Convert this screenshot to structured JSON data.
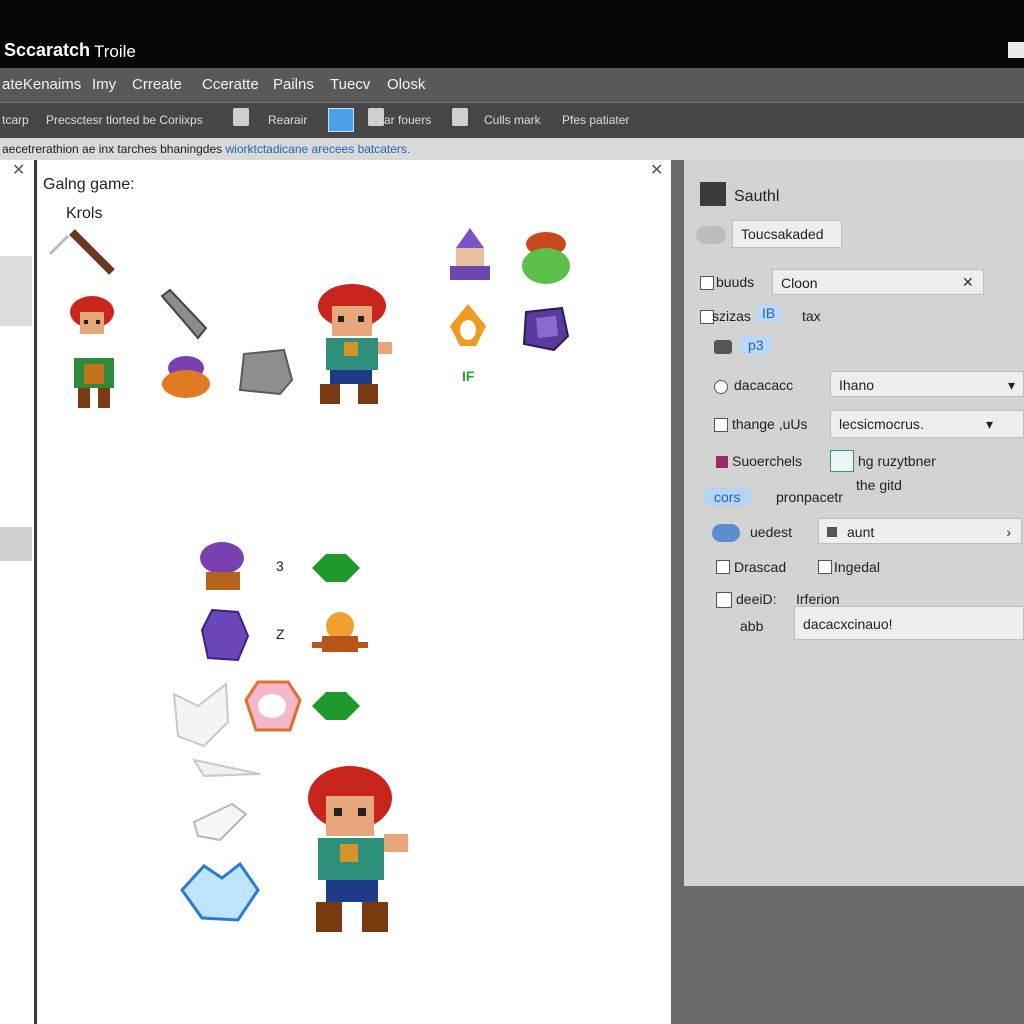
{
  "app": {
    "name": "Sccaratch",
    "window_title": "Troile"
  },
  "menu": [
    "ateKenaims",
    "Imy",
    "Crreate",
    "Cceratte",
    "Pailns",
    "Tuecv",
    "Olosk"
  ],
  "toolbar": {
    "item1": "tcarp",
    "item2": "Precsctesr tlorted be Coriixps",
    "item3": "Rearair",
    "item4": "ar fouers",
    "item5": "Culls mark",
    "item6": "Pfes patiater"
  },
  "status": {
    "text": "aecetrerathion ae inx tarches bhaningdes",
    "link": "wiorktctadicane arecees batcaters."
  },
  "main": {
    "title": "Galng game:",
    "assets_label": "Krols",
    "mark1": "IF",
    "mark2": "3",
    "mark3": "Z"
  },
  "props": {
    "title": "Sauthl",
    "loaded_button": "Toucsakaded",
    "buttons_label": "buuds",
    "buttons_value": "Cloon",
    "sizes_label": "szizas",
    "sizes_value": "IB",
    "sizes_suffix": "tax",
    "pos_value": "p3",
    "dropdown1_label": "dacacacc",
    "dropdown1_value": "Ihano",
    "dropdown2_label": "thange ,uUs",
    "dropdown2_value": "lecsicmocrus.",
    "supercheis_label": "Suoerchels",
    "supercheis_value1": "hg ruzytbner",
    "supercheis_value2": "the gitd",
    "cors_label": "cors",
    "cors_value": "pronpacetr",
    "uedest_label": "uedest",
    "uedest_value": "aunt",
    "check1_label": "Drascad",
    "check2_label": "Ingedal",
    "deeid_label": "deeiD:",
    "deeid_value": "Irferion",
    "abb_label": "abb",
    "abb_value": "dacacxcinauo!"
  }
}
